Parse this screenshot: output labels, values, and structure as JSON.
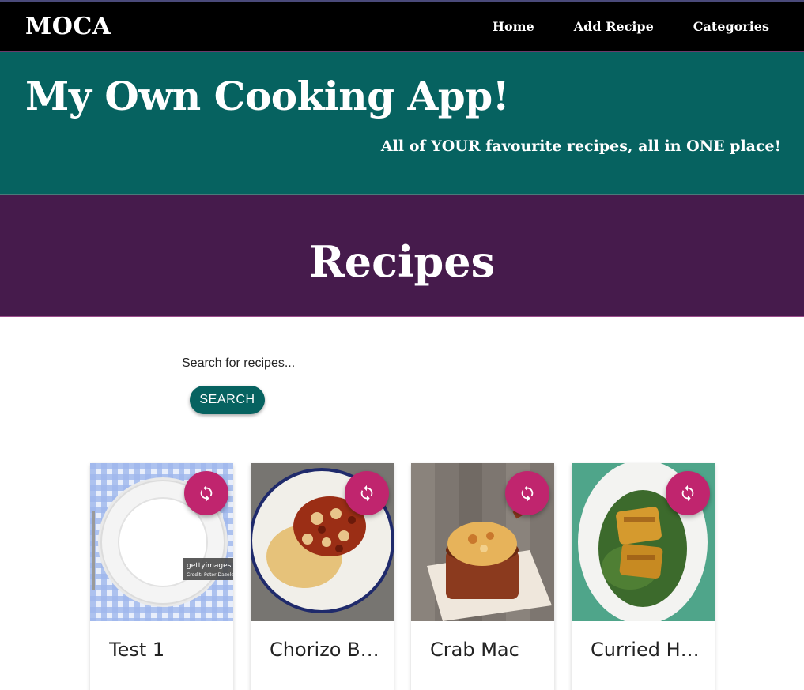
{
  "navbar": {
    "brand": "MOCA",
    "links": [
      {
        "label": "Home"
      },
      {
        "label": "Add Recipe"
      },
      {
        "label": "Categories"
      }
    ]
  },
  "hero": {
    "title": "My Own Cooking App!",
    "subtitle": "All of YOUR favourite recipes, all in ONE place!"
  },
  "recipes_section": {
    "title": "Recipes",
    "search": {
      "placeholder": "Search for recipes...",
      "value": "",
      "button_label": "SEARCH"
    }
  },
  "cards": [
    {
      "title": "Test 1",
      "image": "empty-plate-on-gingham-tablecloth",
      "action_icon": "refresh-icon"
    },
    {
      "title": "Chorizo Beans",
      "image": "chorizo-beans-on-toast",
      "action_icon": "refresh-icon"
    },
    {
      "title": "Crab Mac",
      "image": "crab-mac-and-cheese-pot",
      "action_icon": "refresh-icon"
    },
    {
      "title": "Curried Halibut",
      "image": "curried-fish-on-greens",
      "action_icon": "refresh-icon"
    }
  ],
  "colors": {
    "navbar": "#000000",
    "hero": "#066260",
    "banner": "#461b4c",
    "accent_button": "#066260",
    "fab": "#c0256e"
  }
}
